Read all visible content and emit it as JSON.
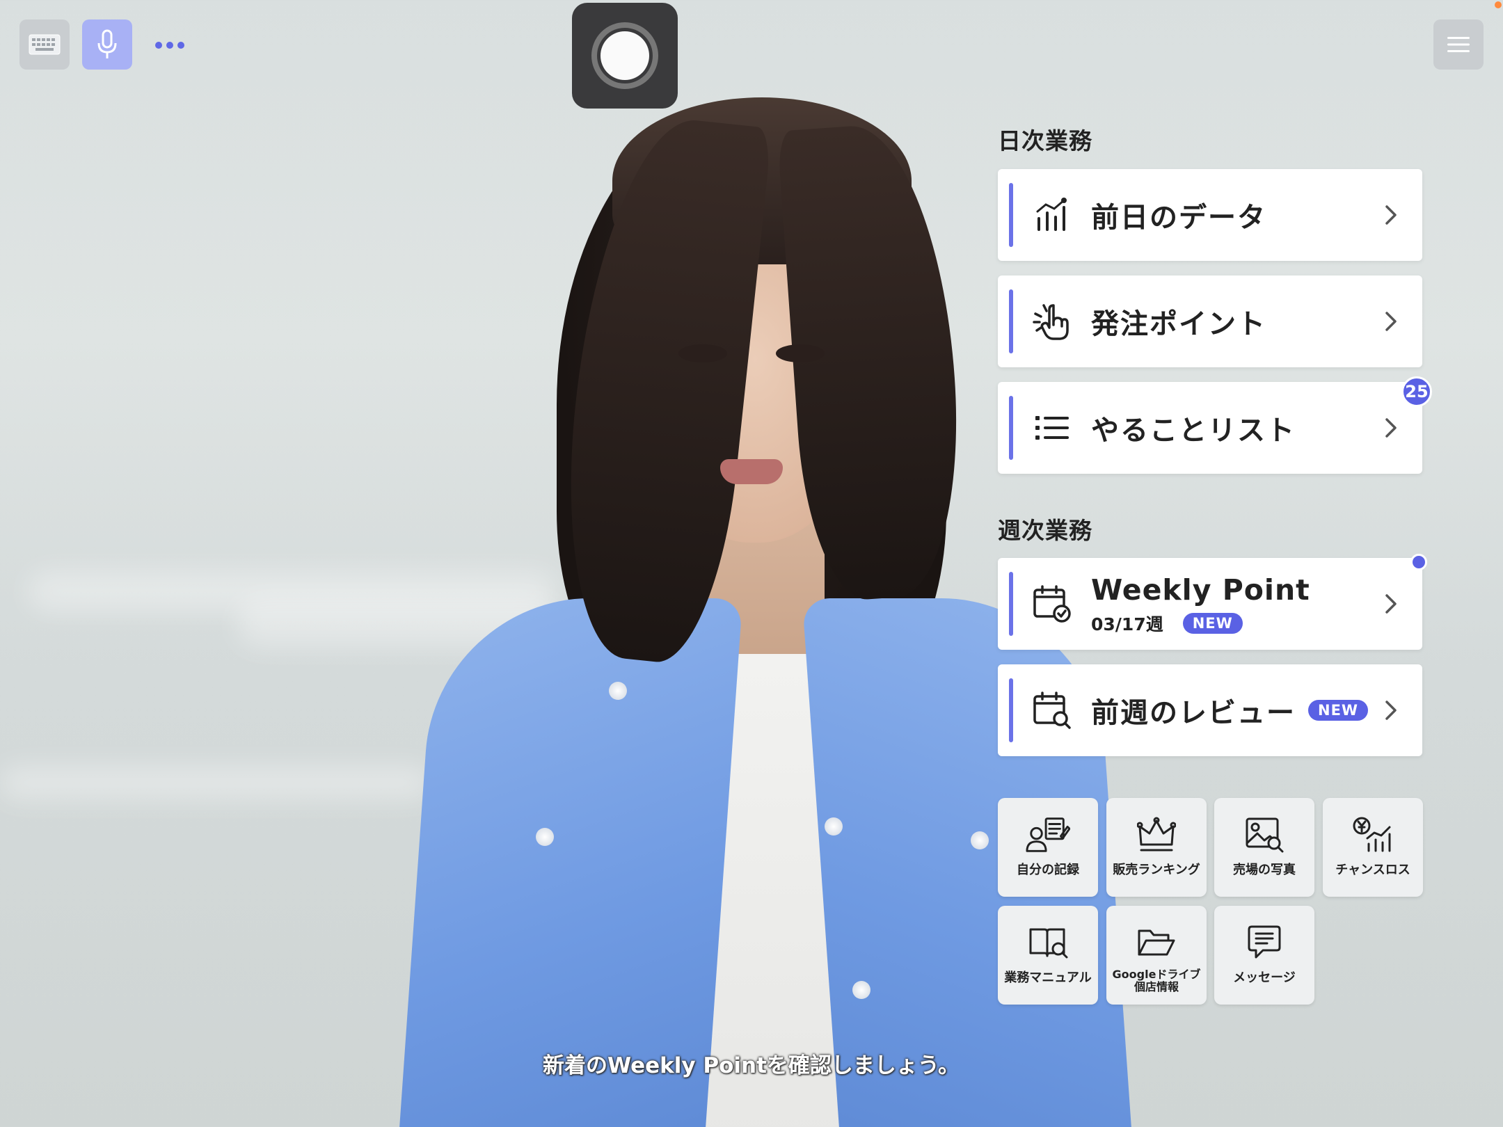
{
  "colors": {
    "accent": "#5a61e4",
    "mic_active": "#a8b1f5",
    "card_bg": "#ffffff",
    "tile_bg": "#eef0f1",
    "record_bg": "#3a3a3c"
  },
  "toolbar": {
    "keyboard_icon": "keyboard-icon",
    "mic_icon": "microphone-icon",
    "more_icon": "more-dots-icon",
    "record_icon": "record-icon",
    "menu_icon": "hamburger-menu-icon"
  },
  "daily": {
    "title": "日次業務",
    "items": [
      {
        "label": "前日のデータ",
        "icon": "bar-chart-icon"
      },
      {
        "label": "発注ポイント",
        "icon": "hand-point-icon"
      },
      {
        "label": "やることリスト",
        "icon": "list-icon",
        "badge": "25"
      }
    ]
  },
  "weekly": {
    "title": "週次業務",
    "items": [
      {
        "label": "Weekly Point",
        "sub": "03/17週",
        "new": "NEW",
        "icon": "calendar-check-icon",
        "unread": true
      },
      {
        "label": "前週のレビュー",
        "new": "NEW",
        "icon": "calendar-search-icon"
      }
    ]
  },
  "tiles": [
    {
      "label": "自分の記録",
      "icon": "person-record-icon"
    },
    {
      "label": "販売ランキング",
      "icon": "crown-icon"
    },
    {
      "label": "売場の写真",
      "icon": "photo-search-icon"
    },
    {
      "label": "チャンスロス",
      "icon": "yen-chart-icon"
    },
    {
      "label": "業務マニュアル",
      "icon": "book-search-icon"
    },
    {
      "label_line1": "Googleドライブ",
      "label_line2": "個店情報",
      "icon": "folder-icon"
    },
    {
      "label": "メッセージ",
      "icon": "message-icon"
    }
  ],
  "caption": "新着のWeekly Pointを確認しましょう。"
}
